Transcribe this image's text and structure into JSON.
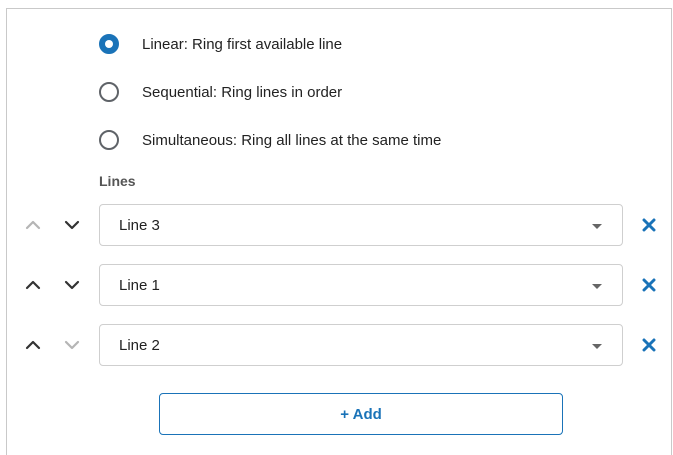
{
  "ring_mode": {
    "options": [
      {
        "label": "Linear: Ring first available line",
        "selected": true
      },
      {
        "label": "Sequential: Ring lines in order",
        "selected": false
      },
      {
        "label": "Simultaneous: Ring all lines at the same time",
        "selected": false
      }
    ]
  },
  "lines_section": {
    "label": "Lines",
    "rows": [
      {
        "value": "Line 3",
        "move_up_enabled": false,
        "move_down_enabled": true
      },
      {
        "value": "Line 1",
        "move_up_enabled": true,
        "move_down_enabled": true
      },
      {
        "value": "Line 2",
        "move_up_enabled": true,
        "move_down_enabled": false
      }
    ]
  },
  "add_button": {
    "label": "+ Add"
  },
  "icons": {
    "move_up": "chevron-up-icon",
    "move_down": "chevron-down-icon",
    "dropdown": "caret-down-icon",
    "remove": "close-icon"
  },
  "colors": {
    "accent": "#1a73b8",
    "arrow_enabled": "#333333",
    "arrow_disabled": "#b5b5b5"
  }
}
